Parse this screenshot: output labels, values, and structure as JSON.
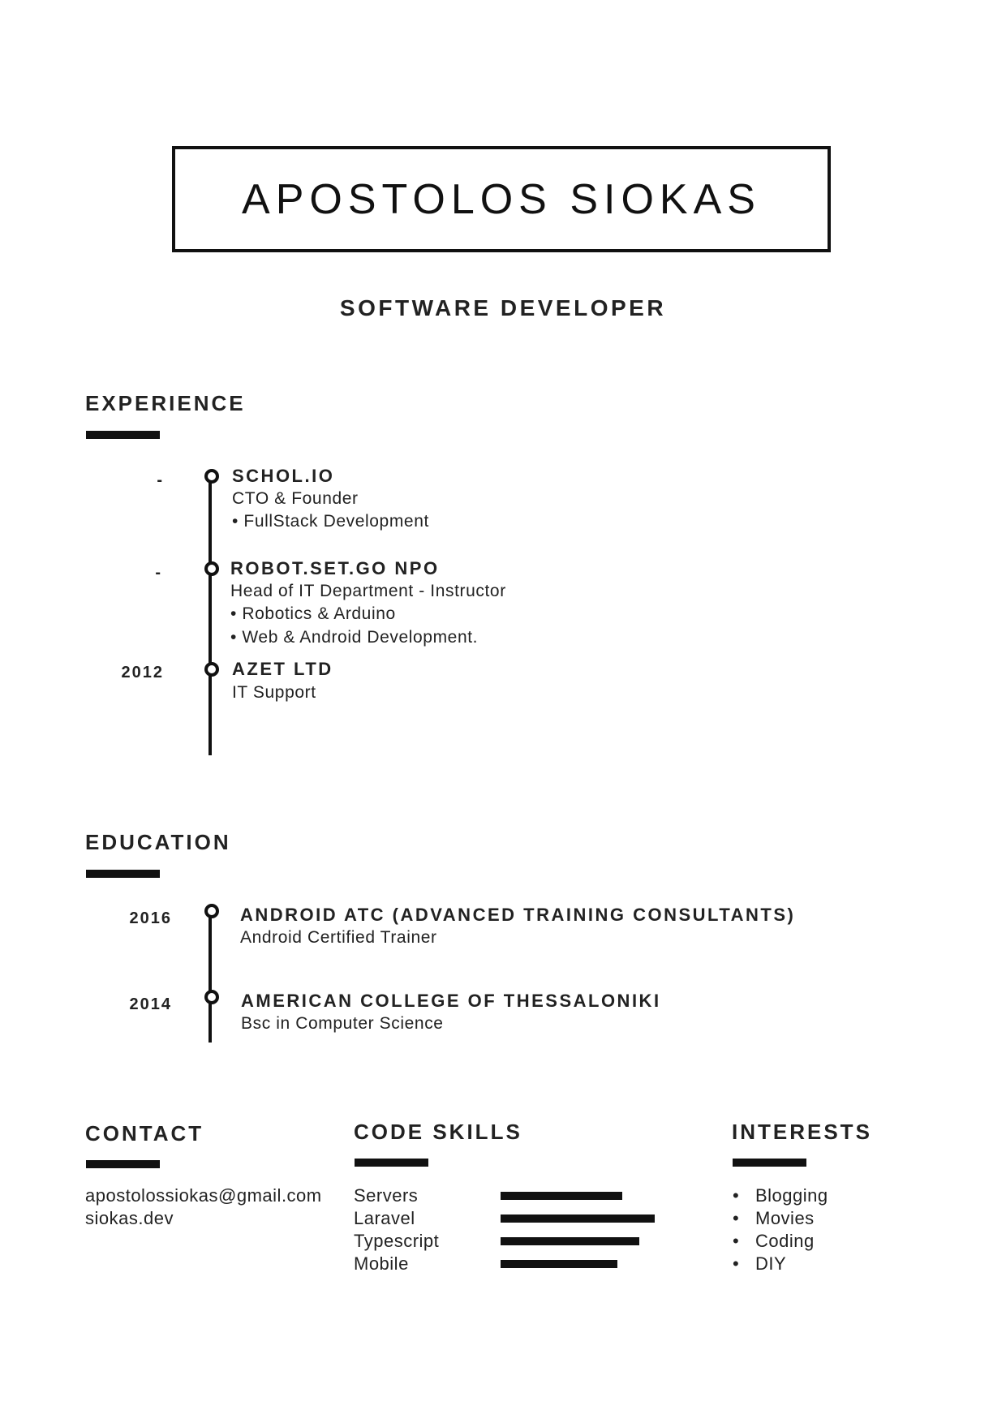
{
  "header": {
    "name": "APOSTOLOS SIOKAS",
    "role": "SOFTWARE DEVELOPER"
  },
  "experience": {
    "heading": "EXPERIENCE",
    "entries": [
      {
        "date": "-",
        "org": "SCHOL.IO",
        "lines": [
          "CTO & Founder",
          "• FullStack Development"
        ]
      },
      {
        "date": "-",
        "org": "ROBOT.SET.GO NPO",
        "lines": [
          "Head of IT Department - Instructor",
          "• Robotics & Arduino",
          "• Web & Android Development."
        ]
      },
      {
        "date": "2012",
        "org": "AZET LTD",
        "lines": [
          "IT Support"
        ]
      }
    ]
  },
  "education": {
    "heading": "EDUCATION",
    "entries": [
      {
        "date": "2016",
        "org": "ANDROID ATC (ADVANCED TRAINING CONSULTANTS)",
        "lines": [
          "Android Certified Trainer"
        ]
      },
      {
        "date": "2014",
        "org": "AMERICAN COLLEGE OF THESSALONIKI",
        "lines": [
          "Bsc in Computer Science"
        ]
      }
    ]
  },
  "contact": {
    "heading": "CONTACT",
    "email": "apostolossiokas@gmail.com",
    "website": "siokas.dev"
  },
  "code_skills": {
    "heading": "CODE SKILLS",
    "items": [
      {
        "name": "Servers",
        "level": 0.79
      },
      {
        "name": "Laravel",
        "level": 1.0
      },
      {
        "name": "Typescript",
        "level": 0.9
      },
      {
        "name": "Mobile",
        "level": 0.76
      }
    ]
  },
  "interests": {
    "heading": "INTERESTS",
    "items": [
      "Blogging",
      "Movies",
      "Coding",
      "DIY"
    ]
  },
  "colors": {
    "ink": "#111111",
    "text": "#222222",
    "paper": "#ffffff"
  }
}
